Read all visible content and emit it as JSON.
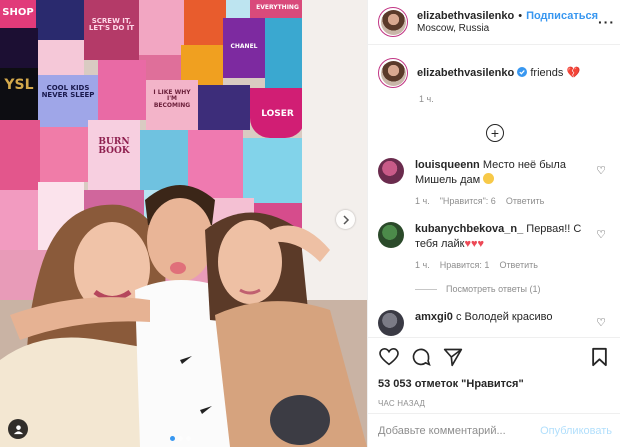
{
  "photo": {
    "wall_texts": [
      "SHOP",
      "SCREW IT, LET'S DO IT",
      "EVERYTHING",
      "COOL KIDS NEVER SLEEP",
      "I LIKE WHY I'M BECOMING",
      "LOSER",
      "BURN BOOK",
      "CHANEL"
    ],
    "carousel_dots": 3,
    "carousel_active": 0
  },
  "header": {
    "username": "elizabethvasilenko",
    "separator": "•",
    "follow_label": "Подписаться",
    "location": "Moscow, Russia"
  },
  "caption": {
    "username": "elizabethvasilenko",
    "text": "friends",
    "time": "1 ч."
  },
  "comments": [
    {
      "username": "louisqueenn",
      "text": "Место неё была Мишель дам",
      "time": "1 ч.",
      "likes": "\"Нравится\": 6",
      "reply": "Ответить"
    },
    {
      "username": "kubanychbekova_n_",
      "text": "Первая!! С тебя лайк",
      "time": "1 ч.",
      "likes": "Нравится: 1",
      "reply": "Ответить"
    }
  ],
  "view_replies": "Посмотреть ответы (1)",
  "partial_comment": {
    "username": "amxgi0",
    "text": "с Володей красиво"
  },
  "likes_count": "53 053 отметок \"Нравится\"",
  "time_ago": "ЧАС НАЗАД",
  "add_comment": {
    "placeholder": "Добавьте комментарий...",
    "publish_label": "Опубликовать"
  },
  "colors": {
    "accent": "#3897f0",
    "heart": "#ed4956",
    "verified": "#3897f0"
  }
}
